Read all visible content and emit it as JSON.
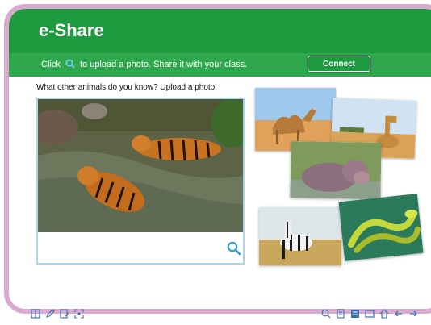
{
  "app": {
    "title": "e-Share"
  },
  "toolbar": {
    "instruction_before": "Click",
    "instruction_after": "to upload a photo. Share it with your class.",
    "connect_label": "Connect"
  },
  "main": {
    "prompt": "What other animals do you know? Upload a photo.",
    "upload_photo_icon": "tigers-photo",
    "upload_button_icon": "search-icon"
  },
  "gallery": [
    {
      "icon": "camel-photo"
    },
    {
      "icon": "giraffe-photo"
    },
    {
      "icon": "hippo-photo"
    },
    {
      "icon": "zebra-photo"
    },
    {
      "icon": "snake-photo"
    }
  ],
  "bottom_toolbar": {
    "left_icons": [
      "book-icon",
      "pen-icon",
      "edit-icon",
      "screen-icon"
    ],
    "right_icons": [
      "zoom-icon",
      "page-icon",
      "list-icon",
      "window-icon",
      "home-icon",
      "back-arrow-icon",
      "forward-arrow-icon"
    ]
  },
  "colors": {
    "header": "#1e9a3f",
    "toolbar": "#2fa84d",
    "frame": "#d9a9cf",
    "accent": "#2d9fd3"
  }
}
